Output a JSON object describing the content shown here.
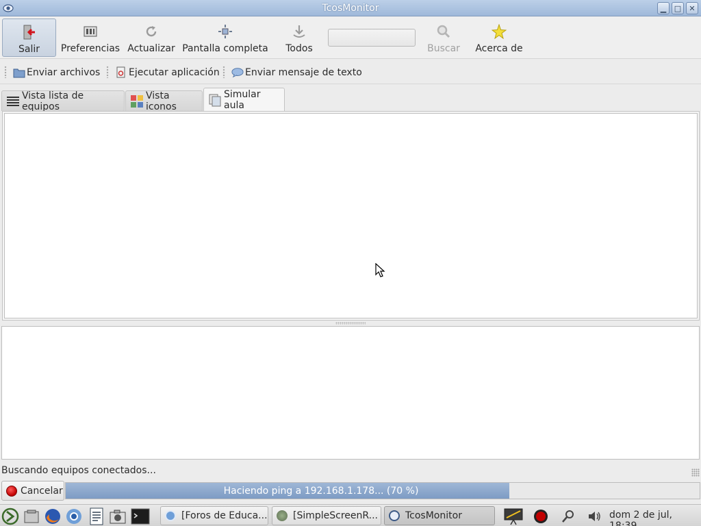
{
  "window": {
    "title": "TcosMonitor"
  },
  "toolbar": {
    "exit_label": "Salir",
    "prefs_label": "Preferencias",
    "refresh_label": "Actualizar",
    "fullscreen_label": "Pantalla completa",
    "all_label": "Todos",
    "search_value": "",
    "search_label": "Buscar",
    "about_label": "Acerca de"
  },
  "actions": {
    "send_files": "Enviar archivos",
    "run_app": "Ejecutar aplicación",
    "send_message": "Enviar mensaje de texto"
  },
  "tabs": [
    {
      "label": "Vista lista de equipos",
      "selected": false
    },
    {
      "label": "Vista iconos",
      "selected": false
    },
    {
      "label": "Simular aula",
      "selected": true
    }
  ],
  "status": {
    "text": "Buscando equipos conectados..."
  },
  "progress": {
    "cancel_label": "Cancelar",
    "text": "Haciendo ping a 192.168.1.178... (70 %)",
    "fraction": 0.7
  },
  "taskbar": {
    "tasks": [
      {
        "label": "[Foros de Educa..."
      },
      {
        "label": "[SimpleScreenR..."
      },
      {
        "label": "TcosMonitor"
      }
    ],
    "clock": "dom  2 de jul, 18:39"
  },
  "colors": {
    "titlebar": "#a9c0de",
    "progress_fill": "#8aa6cc",
    "record_red": "#c00000"
  }
}
